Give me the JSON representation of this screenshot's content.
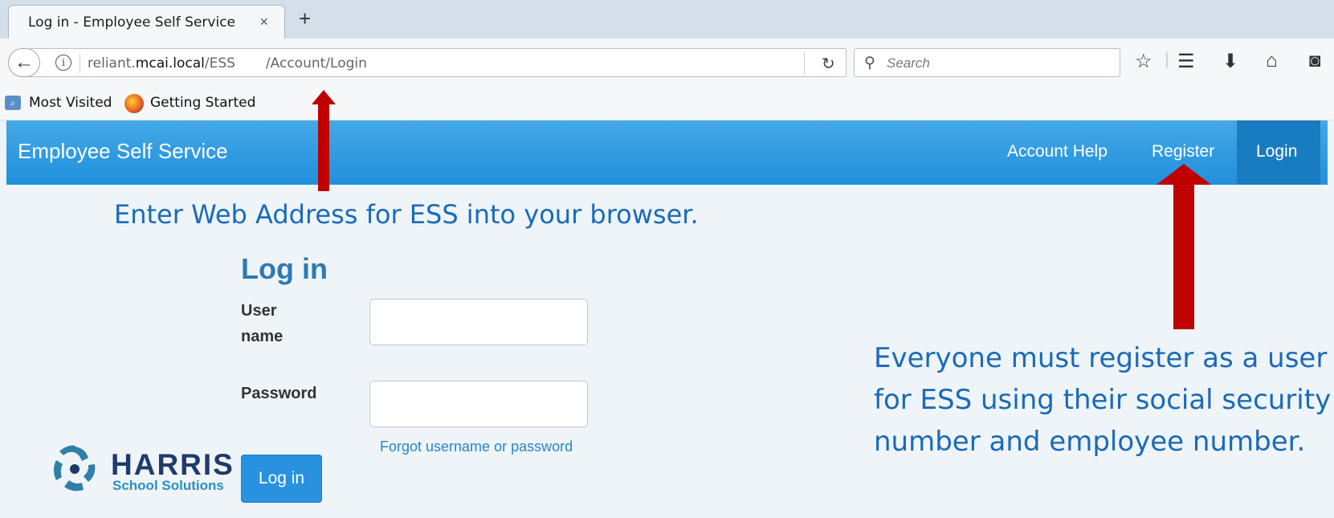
{
  "browser": {
    "tab_title": "Log in - Employee Self Service",
    "tab_close": "×",
    "new_tab": "+",
    "url": {
      "scheme_host_prefix": "reliant.",
      "host_bold": "mcai.local",
      "path_1": "/ESS",
      "path_2": "/Account/Login"
    },
    "search_placeholder": "Search",
    "bookmarks": [
      "Most Visited",
      "Getting Started"
    ],
    "toolbar_icons": [
      "bookmark-star-icon",
      "reading-list-icon",
      "download-icon",
      "home-icon",
      "pocket-icon"
    ]
  },
  "site": {
    "brand": "Employee Self Service",
    "nav": {
      "account_help": "Account Help",
      "register": "Register",
      "login": "Login"
    }
  },
  "annotations": {
    "url_hint": "Enter Web Address for ESS into your browser.",
    "register_hint_lines": [
      "Everyone must register as a user",
      "for ESS using their social security",
      "number and employee number."
    ]
  },
  "login_form": {
    "title": "Log in",
    "username_label_line1": "User",
    "username_label_line2": "name",
    "username_value": "",
    "password_label": "Password",
    "password_value": "",
    "forgot_link": "Forgot username or password",
    "submit_label": "Log in"
  },
  "logo": {
    "name": "HARRIS",
    "subtitle": "School Solutions"
  },
  "colors": {
    "header_blue": "#2090dc",
    "login_active": "#1a7cc0",
    "annotation_text": "#1a6ab8",
    "arrow_red": "#c00000"
  }
}
